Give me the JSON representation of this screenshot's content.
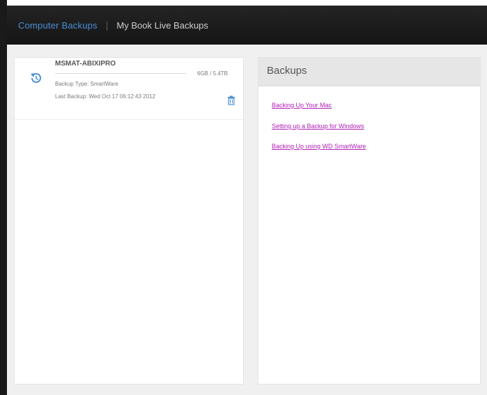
{
  "header": {
    "tabs": [
      {
        "label": "Computer Backups",
        "active": true
      },
      {
        "label": "My Book Live Backups",
        "active": false
      }
    ],
    "separator": "|"
  },
  "device": {
    "name": "MSMAT-ABIXIPRO",
    "size": "6GB / 5.4TB",
    "backup_type": "Backup Type: SmartWare",
    "last_backup": "Last Backup: Wed Oct 17 06:12:43 2012",
    "icon": "backup-history-icon",
    "delete_icon": "trash-icon"
  },
  "backups_panel": {
    "title": "Backups",
    "links": [
      "Backing Up Your Mac",
      "Setting up a Backup for Windows",
      "Backing Up using WD SmartWare"
    ]
  },
  "colors": {
    "header_bg": "#1c1c1c",
    "active_tab": "#4a90d9",
    "link": "#b01fb5",
    "content_bg": "#f0f0f0"
  }
}
